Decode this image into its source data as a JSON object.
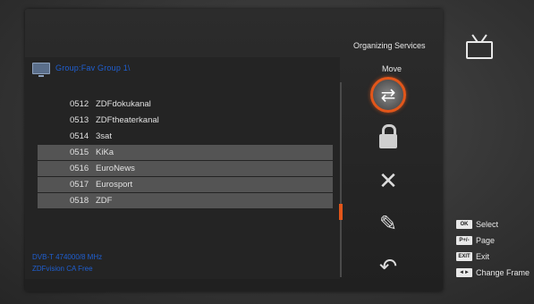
{
  "panel": {
    "title": "Organizing Services",
    "mode": "Move",
    "group_title": "Group:Fav Group 1\\"
  },
  "channels": [
    {
      "num": "0512",
      "name": "ZDFdokukanal",
      "highlighted": false
    },
    {
      "num": "0513",
      "name": "ZDFtheaterkanal",
      "highlighted": false
    },
    {
      "num": "0514",
      "name": "3sat",
      "highlighted": false
    },
    {
      "num": "0515",
      "name": "KiKa",
      "highlighted": true
    },
    {
      "num": "0516",
      "name": "EuroNews",
      "highlighted": true
    },
    {
      "num": "0517",
      "name": "Eurosport",
      "highlighted": true
    },
    {
      "num": "0518",
      "name": "ZDF",
      "highlighted": true
    }
  ],
  "info": {
    "line1": "DVB-T  474000/8 MHz",
    "line2": "ZDFvision  CA Free"
  },
  "tools": [
    {
      "icon": "move-icon",
      "active": true
    },
    {
      "icon": "lock-icon",
      "active": false
    },
    {
      "icon": "delete-icon",
      "active": false
    },
    {
      "icon": "rename-icon",
      "active": false
    },
    {
      "icon": "back-icon",
      "active": false
    }
  ],
  "hints": [
    {
      "key": "OK",
      "label": "Select"
    },
    {
      "key": "P+/-",
      "label": "Page"
    },
    {
      "key": "EXIT",
      "label": "Exit"
    },
    {
      "key": "◄►",
      "label": "Change Frame"
    }
  ],
  "scroll_position": 0.62,
  "colors": {
    "accent": "#e2561a",
    "info_text": "#1f5fd1"
  }
}
